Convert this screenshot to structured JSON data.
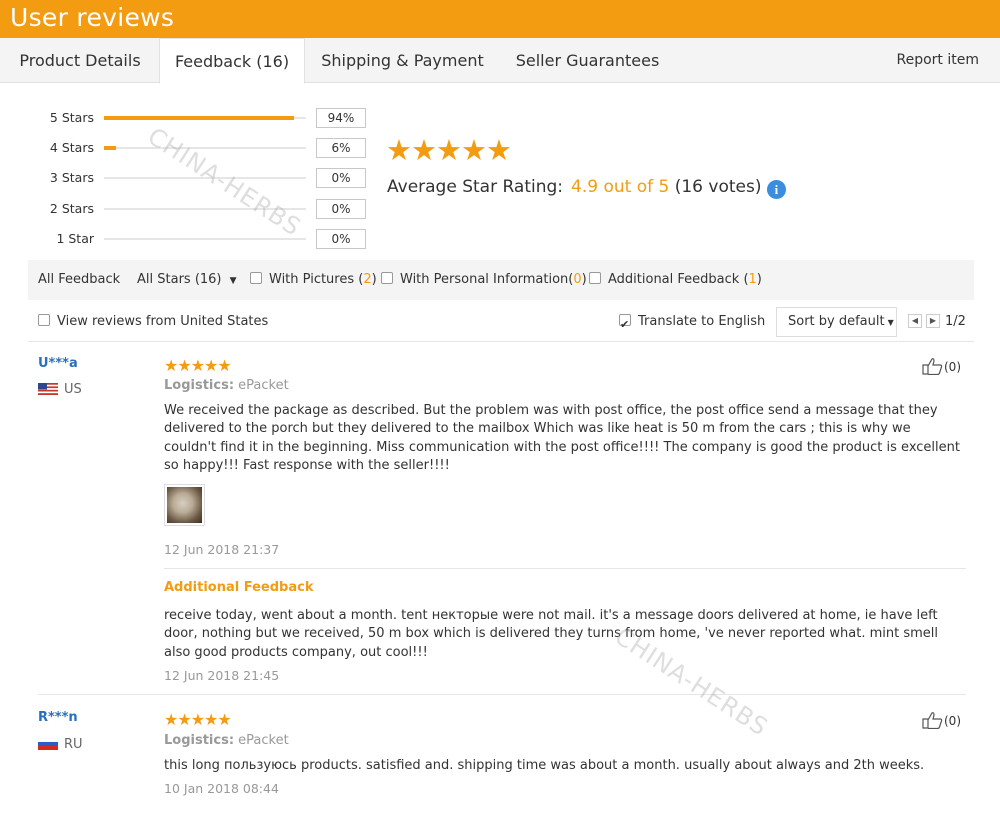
{
  "banner": {
    "title": "User reviews"
  },
  "tabs": [
    {
      "label": "Product Details"
    },
    {
      "label": "Feedback (16)"
    },
    {
      "label": "Shipping & Payment"
    },
    {
      "label": "Seller Guarantees"
    }
  ],
  "report_label": "Report item",
  "histogram": [
    {
      "label": "5 Stars",
      "percent_label": "94%",
      "fraction": 0.94
    },
    {
      "label": "4 Stars",
      "percent_label": "6%",
      "fraction": 0.06
    },
    {
      "label": "3 Stars",
      "percent_label": "0%",
      "fraction": 0
    },
    {
      "label": "2 Stars",
      "percent_label": "0%",
      "fraction": 0
    },
    {
      "label": "1 Star",
      "percent_label": "0%",
      "fraction": 0
    }
  ],
  "rating": {
    "stars": 5,
    "label": "Average Star Rating:",
    "value": "4.9 out of 5",
    "votes": "(16 votes)"
  },
  "filters": {
    "all_feedback": "All Feedback",
    "all_stars": "All Stars (16)",
    "with_pictures": {
      "label": "With Pictures",
      "count_open": "(",
      "count": "2",
      "count_close": ")"
    },
    "with_personal": {
      "label": "With Personal Information",
      "count_open": "(",
      "count": "0",
      "count_close": ")"
    },
    "additional": {
      "label": "Additional Feedback ",
      "count_open": "(",
      "count": "1",
      "count_close": ")"
    },
    "view_us": "View reviews from United States",
    "translate": "Translate to English",
    "translate_checked": true,
    "sort": "Sort by default",
    "pagination": "1/2"
  },
  "reviews": [
    {
      "user": "U***a",
      "country": "US",
      "stars": 5,
      "logistics_label": "Logistics:",
      "logistics_value": "ePacket",
      "text": "We received the package as described. But the problem was with post office, the post office send a message that they delivered to the porch but they delivered to the mailbox Which was like heat is 50 m from the cars ; this is why we couldn't find it in the beginning. Miss communication with the post office!!!! The company is good the product is excellent so happy!!! Fast response with the seller!!!!",
      "date": "12 Jun 2018 21:37",
      "helpful": "(0)",
      "additional_title": "Additional Feedback",
      "additional_text": "receive today, went about a month. tent некторые were not mail. it's a message doors delivered at home, ie have left door, nothing but we received, 50 m box which is delivered they turns from home, 've never reported what. mint smell also good products company, out cool!!!",
      "additional_date": "12 Jun 2018 21:45"
    },
    {
      "user": "R***n",
      "country": "RU",
      "stars": 5,
      "logistics_label": "Logistics:",
      "logistics_value": "ePacket",
      "text": "this long пользуюсь products. satisfied and. shipping time was about a month. usually about always and 2th weeks.",
      "date": "10 Jan 2018 08:44",
      "helpful": "(0)"
    }
  ],
  "watermark": "CHINA-HERBS",
  "colors": {
    "accent": "#f39c12",
    "link": "#2a6fbf",
    "info": "#3b8de0"
  }
}
